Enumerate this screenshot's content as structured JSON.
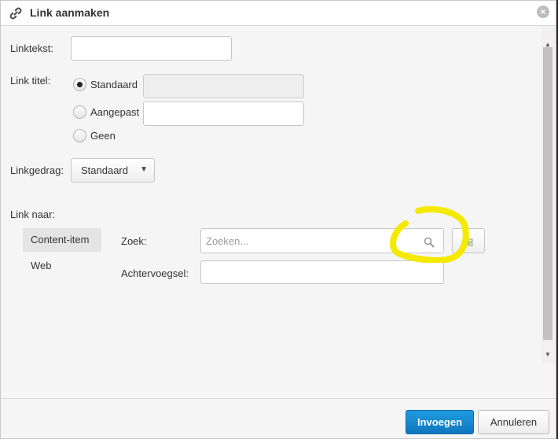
{
  "dialog": {
    "title": "Link aanmaken",
    "close_icon": "close-icon",
    "title_icon": "link-icon"
  },
  "form": {
    "linktekst": {
      "label": "Linktekst:",
      "value": ""
    },
    "linktitel": {
      "label": "Link titel:",
      "options": [
        {
          "label": "Standaard",
          "checked": true
        },
        {
          "label": "Aangepast",
          "checked": false
        },
        {
          "label": "Geen",
          "checked": false
        }
      ],
      "standaard_value": "",
      "aangepast_value": ""
    },
    "linkgedrag": {
      "label": "Linkgedrag:",
      "selected": "Standaard"
    },
    "link_naar": {
      "label": "Link naar:",
      "tabs": [
        {
          "label": "Content-item",
          "active": true
        },
        {
          "label": "Web",
          "active": false
        }
      ],
      "zoek": {
        "label": "Zoek:",
        "placeholder": "Zoeken...",
        "value": ""
      },
      "achtervoegsel": {
        "label": "Achtervoegsel:",
        "value": ""
      }
    }
  },
  "footer": {
    "insert_label": "Invoegen",
    "cancel_label": "Annuleren"
  },
  "colors": {
    "primary_button": "#1a8bd6",
    "highlight_annotation": "#f5e900"
  }
}
